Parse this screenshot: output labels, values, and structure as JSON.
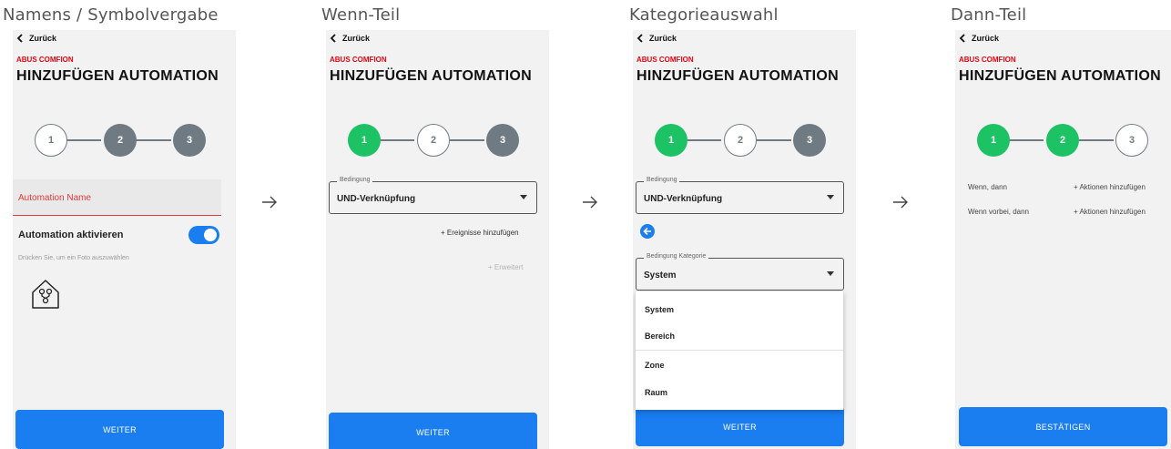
{
  "screens": [
    {
      "caption": "Namens / Symbolvergabe",
      "back": "Zurück",
      "brand": "ABUS COMFION",
      "title": "HINZUFÜGEN AUTOMATION",
      "steps": [
        "1",
        "2",
        "3"
      ],
      "name_field_label": "Automation Name",
      "toggle_label": "Automation aktivieren",
      "toggle_on": true,
      "photo_hint": "Drücken Sie, um ein Foto auszuwählen",
      "icon": "home-automation-icon",
      "button": "WEITER"
    },
    {
      "caption": "Wenn-Teil",
      "back": "Zurück",
      "brand": "ABUS COMFION",
      "title": "HINZUFÜGEN AUTOMATION",
      "steps": [
        "1",
        "2",
        "3"
      ],
      "condition_legend": "Bedingung",
      "condition_value": "UND-Verknüpfung",
      "add_events": "+ Ereignisse hinzufügen",
      "advanced": "+ Erweitert",
      "button": "WEITER"
    },
    {
      "caption": "Kategorieauswahl",
      "back": "Zurück",
      "brand": "ABUS COMFION",
      "title": "HINZUFÜGEN AUTOMATION",
      "steps": [
        "1",
        "2",
        "3"
      ],
      "condition_legend": "Bedingung",
      "condition_value": "UND-Verknüpfung",
      "category_legend": "Bedingung Kategorie",
      "category_value": "System",
      "options": [
        "System",
        "Bereich",
        "Zone",
        "Raum"
      ],
      "button": "WEITER"
    },
    {
      "caption": "Dann-Teil",
      "back": "Zurück",
      "brand": "ABUS COMFION",
      "title": "HINZUFÜGEN AUTOMATION",
      "steps": [
        "1",
        "2",
        "3"
      ],
      "rules": [
        {
          "label": "Wenn, dann",
          "action": "+ Aktionen hinzufügen"
        },
        {
          "label": "Wenn vorbei, dann",
          "action": "+ Aktionen hinzufügen"
        }
      ],
      "button": "BESTÄTIGEN"
    }
  ],
  "colors": {
    "accent_blue": "#1a7df0",
    "step_green": "#1dc264",
    "step_grey": "#707a82",
    "brand_red": "#e30613",
    "error_red": "#e33a3a"
  },
  "flow_arrow_icon": "arrow-right-icon"
}
